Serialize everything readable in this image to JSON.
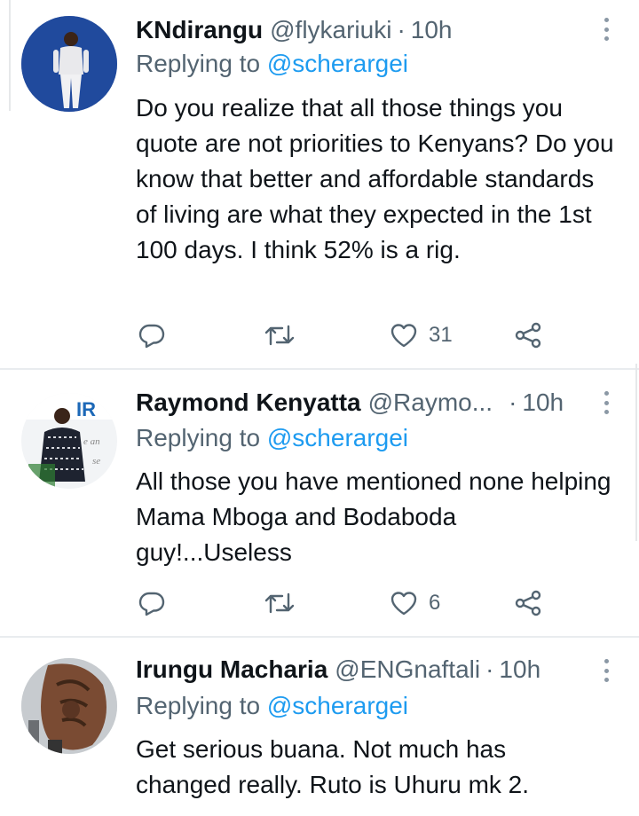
{
  "tweets": [
    {
      "name": "KNdirangu",
      "handle": "@flykariuki",
      "time": "10h",
      "replying_prefix": "Replying to",
      "replying_to": "@scherargei",
      "text": "Do you realize that all those things you quote are not priorities to Kenyans? Do you know that better and affordable standards of living are what they expected in the 1st 100 days. I think 52% is a rig.",
      "likes": "31"
    },
    {
      "name": "Raymond Kenyatta",
      "handle": "@Raymo...",
      "time": "10h",
      "replying_prefix": "Replying to",
      "replying_to": "@scherargei",
      "text": "All those you have mentioned none helping Mama Mboga and Bodaboda guy!...Useless",
      "likes": "6"
    },
    {
      "name": "Irungu Macharia",
      "handle": "@ENGnaftali",
      "time": "10h",
      "replying_prefix": "Replying to",
      "replying_to": "@scherargei",
      "text": "Get serious buana. Not much has changed really. Ruto is Uhuru mk 2."
    }
  ],
  "icons": {
    "reply": "reply-icon",
    "retweet": "retweet-icon",
    "like": "heart-icon",
    "share": "share-icon",
    "more": "more-icon"
  },
  "colors": {
    "text": "#0f1419",
    "secondary": "#536471",
    "link": "#1d9bf0",
    "divider": "#e9ecef"
  }
}
